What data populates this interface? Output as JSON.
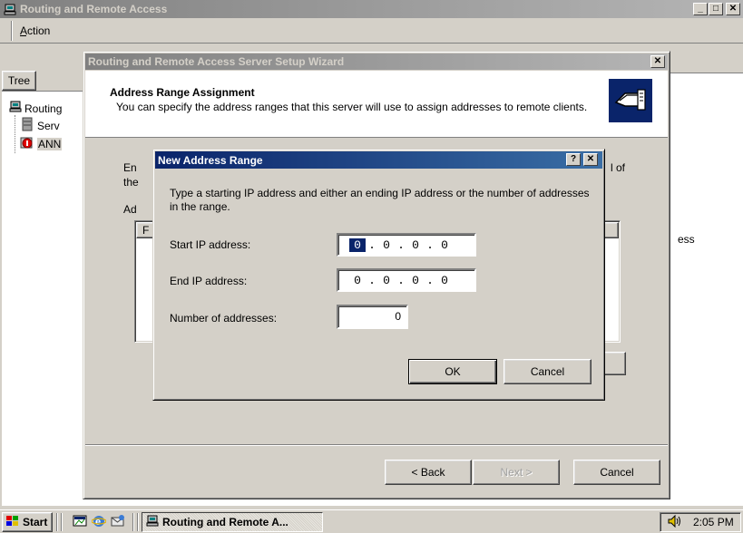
{
  "main_window": {
    "title": "Routing and Remote Access",
    "menu": {
      "action": "Action"
    },
    "tree_tab": "Tree",
    "tree": [
      {
        "label": "Routing"
      },
      {
        "label": "Serv"
      },
      {
        "label": "ANN"
      }
    ],
    "right_fragment": "ess"
  },
  "wizard": {
    "title": "Routing and Remote Access Server Setup Wizard",
    "heading": "Address Range Assignment",
    "subheading": "You can specify the address ranges that this server will use to assign addresses to remote clients.",
    "body_fragments": {
      "line1_left": "En",
      "line1_right": "l of",
      "line2_left": "the",
      "list_label_left": "Ad",
      "col_header_left": "F"
    },
    "buttons": {
      "back": "< Back",
      "next": "Next >",
      "cancel": "Cancel"
    }
  },
  "dialog": {
    "title": "New Address Range",
    "help_button": "?",
    "close_button": "✕",
    "description": "Type a starting IP address and either an ending IP address or the number of addresses in the range.",
    "fields": {
      "start_label": "Start IP address:",
      "start_ip": [
        "0",
        "0",
        "0",
        "0"
      ],
      "end_label": "End IP address:",
      "end_ip": [
        "0",
        "0",
        "0",
        "0"
      ],
      "count_label": "Number of addresses:",
      "count_value": "0"
    },
    "buttons": {
      "ok": "OK",
      "cancel": "Cancel"
    }
  },
  "taskbar": {
    "start": "Start",
    "task_button": "Routing and Remote A...",
    "clock": "2:05 PM"
  },
  "colors": {
    "active_title": "#0a246a",
    "inactive_title": "#808080",
    "face": "#d4d0c8"
  }
}
